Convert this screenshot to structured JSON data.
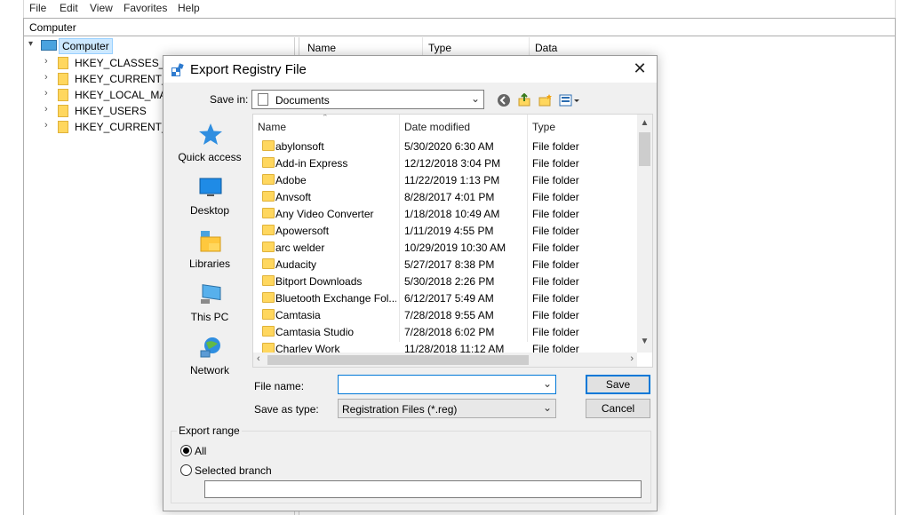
{
  "regedit": {
    "menu": [
      "File",
      "Edit",
      "View",
      "Favorites",
      "Help"
    ],
    "address": "Computer",
    "tree": {
      "root": "Computer",
      "keys": [
        "HKEY_CLASSES_RO",
        "HKEY_CURRENT_US",
        "HKEY_LOCAL_MAC",
        "HKEY_USERS",
        "HKEY_CURRENT_C"
      ]
    },
    "columns": [
      "Name",
      "Type",
      "Data"
    ]
  },
  "dialog": {
    "title": "Export Registry File",
    "close_glyph": "✕",
    "save_in_label": "Save in:",
    "save_in_value": "Documents",
    "places": [
      "Quick access",
      "Desktop",
      "Libraries",
      "This PC",
      "Network"
    ],
    "list_columns": [
      "Name",
      "Date modified",
      "Type"
    ],
    "files": [
      {
        "name": "abylonsoft",
        "date": "5/30/2020 6:30 AM",
        "type": "File folder"
      },
      {
        "name": "Add-in Express",
        "date": "12/12/2018 3:04 PM",
        "type": "File folder"
      },
      {
        "name": "Adobe",
        "date": "11/22/2019 1:13 PM",
        "type": "File folder"
      },
      {
        "name": "Anvsoft",
        "date": "8/28/2017 4:01 PM",
        "type": "File folder"
      },
      {
        "name": "Any Video Converter",
        "date": "1/18/2018 10:49 AM",
        "type": "File folder"
      },
      {
        "name": "Apowersoft",
        "date": "1/11/2019 4:55 PM",
        "type": "File folder"
      },
      {
        "name": "arc welder",
        "date": "10/29/2019 10:30 AM",
        "type": "File folder"
      },
      {
        "name": "Audacity",
        "date": "5/27/2017 8:38 PM",
        "type": "File folder"
      },
      {
        "name": "Bitport Downloads",
        "date": "5/30/2018 2:26 PM",
        "type": "File folder"
      },
      {
        "name": "Bluetooth Exchange Fol...",
        "date": "6/12/2017 5:49 AM",
        "type": "File folder"
      },
      {
        "name": "Camtasia",
        "date": "7/28/2018 9:55 AM",
        "type": "File folder"
      },
      {
        "name": "Camtasia Studio",
        "date": "7/28/2018 6:02 PM",
        "type": "File folder"
      },
      {
        "name": "Charley Work",
        "date": "11/28/2018 11:12 AM",
        "type": "File folder"
      }
    ],
    "file_name_label": "File name:",
    "file_name_value": "",
    "save_as_type_label": "Save as type:",
    "save_as_type_value": "Registration Files (*.reg)",
    "save_label": "Save",
    "cancel_label": "Cancel",
    "export_range": {
      "legend": "Export range",
      "all_label": "All",
      "selected_label": "Selected branch",
      "selected_option": "All",
      "branch_value": ""
    }
  },
  "colors": {
    "accent": "#0078d7",
    "folder": "#ffd75e",
    "dialog_bg": "#f0f0f0"
  }
}
